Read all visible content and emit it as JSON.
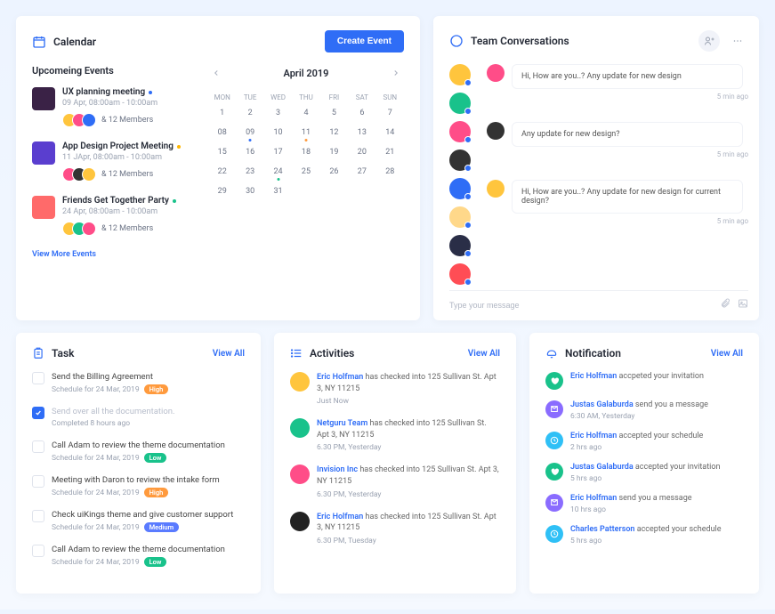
{
  "calendar": {
    "title": "Calendar",
    "create_btn": "Create Event",
    "upcoming_h": "Upcomeing Events",
    "events": [
      {
        "title": "UX planning meeting",
        "time": "09 Apr, 08:00am - 10:00am",
        "members": "& 12 Members",
        "thumb": "#3a2246",
        "dot": "#2f6df6",
        "av": [
          "#ffc53d",
          "#ff4d88",
          "#2f6df6"
        ]
      },
      {
        "title": "App Design Project Meeting",
        "time": "11 JApr, 08:00am - 10:00am",
        "members": "& 12 Members",
        "thumb": "#5a3ecf",
        "dot": "#ffb600",
        "av": [
          "#ff4d88",
          "#333",
          "#ffc53d"
        ]
      },
      {
        "title": "Friends Get Together Party",
        "time": "24 Apr, 08:00am - 10:00am",
        "members": "& 12 Members",
        "thumb": "#ff6a6a",
        "dot": "#19c28b",
        "av": [
          "#ffc53d",
          "#19c28b",
          "#ff4d88"
        ]
      }
    ],
    "view_more": "View More Events",
    "month": "April 2019",
    "dow": [
      "MON",
      "TUE",
      "WED",
      "THU",
      "FRI",
      "SAT",
      "SUN"
    ],
    "days": [
      {
        "n": "1"
      },
      {
        "n": "2"
      },
      {
        "n": "3"
      },
      {
        "n": "4"
      },
      {
        "n": "5"
      },
      {
        "n": "6"
      },
      {
        "n": "7"
      },
      {
        "n": "08"
      },
      {
        "n": "09",
        "m": "#2f6df6"
      },
      {
        "n": "10"
      },
      {
        "n": "11",
        "m": "#ff9a3d"
      },
      {
        "n": "12"
      },
      {
        "n": "13"
      },
      {
        "n": "14"
      },
      {
        "n": "15"
      },
      {
        "n": "16"
      },
      {
        "n": "17"
      },
      {
        "n": "18"
      },
      {
        "n": "19"
      },
      {
        "n": "20"
      },
      {
        "n": "21"
      },
      {
        "n": "22"
      },
      {
        "n": "23"
      },
      {
        "n": "24",
        "m": "#19c28b"
      },
      {
        "n": "25"
      },
      {
        "n": "26"
      },
      {
        "n": "27"
      },
      {
        "n": "28"
      },
      {
        "n": "29"
      },
      {
        "n": "30"
      },
      {
        "n": "31"
      }
    ]
  },
  "conversations": {
    "title": "Team Conversations",
    "list": [
      {
        "bg": "#ffc53d"
      },
      {
        "bg": "#19c28b"
      },
      {
        "bg": "#ff4d88"
      },
      {
        "bg": "#333"
      },
      {
        "bg": "#2f6df6"
      },
      {
        "bg": "#ffd88a"
      },
      {
        "bg": "#2a2e47"
      },
      {
        "bg": "#ff4d55"
      }
    ],
    "groups": [
      {
        "msgs": [
          "Hi, How are you..? Any update for new design"
        ],
        "av": "#ff4d88",
        "time": "5 min ago"
      },
      {
        "msgs": [
          "Any update for new design?"
        ],
        "av": "#333",
        "time": "5 min ago"
      },
      {
        "msgs": [
          "Hi, How are you..? Any update for new design for current design?"
        ],
        "av": "#ffc53d",
        "time": "5 min ago"
      }
    ],
    "placeholder": "Type your message"
  },
  "tasks": {
    "title": "Task",
    "view_all": "View All",
    "items": [
      {
        "title": "Send the Billing Agreement",
        "sub": "Schedule for 24 Mar, 2019",
        "pill": "High",
        "pc": "#ff9a3d",
        "done": false
      },
      {
        "title": "Send over all the documentation.",
        "sub": "Completed 8 hours ago",
        "done": true
      },
      {
        "title": "Call Adam to review the theme documentation",
        "sub": "Schedule for 24 Mar, 2019",
        "pill": "Low",
        "pc": "#19c28b",
        "done": false
      },
      {
        "title": "Meeting with Daron to review the intake form",
        "sub": "Schedule for 24 Mar, 2019",
        "pill": "High",
        "pc": "#ff9a3d",
        "done": false
      },
      {
        "title": "Check  uiKings theme  and  give customer support",
        "sub": "Schedule for 24 Mar, 2019",
        "pill": "Medium",
        "pc": "#5a7bff",
        "done": false
      },
      {
        "title": "Call Adam to review the theme documentation",
        "sub": "Schedule for 24 Mar, 2019",
        "pill": "Low",
        "pc": "#19c28b",
        "done": false
      }
    ]
  },
  "activities": {
    "title": "Activities",
    "view_all": "View All",
    "items": [
      {
        "name": "Eric Holfman",
        "text": " has checked into 125 Sullivan St. Apt 3, NY 11215",
        "time": "Just Now",
        "av": "#ffc53d"
      },
      {
        "name": "Netguru Team",
        "text": "  has checked into 125 Sullivan St. Apt 3, NY 11215",
        "time": "6.30 PM, Yesterday",
        "av": "#19c28b"
      },
      {
        "name": "Invision Inc",
        "text": " has checked into 125 Sullivan St. Apt 3, NY 11215",
        "time": "6.30 PM, Yesterday",
        "av": "#ff4d88"
      },
      {
        "name": "Eric Holfman",
        "text": " has checked into 125 Sullivan St. Apt 3, NY 11215",
        "time": "6.30 PM, Tuesday",
        "av": "#222"
      }
    ]
  },
  "notifications": {
    "title": "Notification",
    "view_all": "View All",
    "items": [
      {
        "name": "Eric Holfman",
        "text": " accpeted your invitation",
        "time": "",
        "ic": "heart",
        "bg": "#19c28b"
      },
      {
        "name": "Justas Galaburda",
        "text": " send you a message",
        "time": "6:30 AM, Yesterday",
        "ic": "msg",
        "bg": "#8a6cff"
      },
      {
        "name": "Eric Holfman",
        "text": "  accepted your schedule",
        "time": "2 hrs ago",
        "ic": "clock",
        "bg": "#2fc0f6"
      },
      {
        "name": "Justas Galaburda",
        "text": "  accepted your invitation",
        "time": "5 hrs ago",
        "ic": "heart",
        "bg": "#19c28b"
      },
      {
        "name": "Eric Holfman",
        "text": " send you a message",
        "time": "10 hrs ago",
        "ic": "msg",
        "bg": "#8a6cff"
      },
      {
        "name": "Charles Patterson",
        "text": "  accepted your schedule",
        "time": "5 hrs ago",
        "ic": "clock",
        "bg": "#2fc0f6"
      }
    ]
  }
}
